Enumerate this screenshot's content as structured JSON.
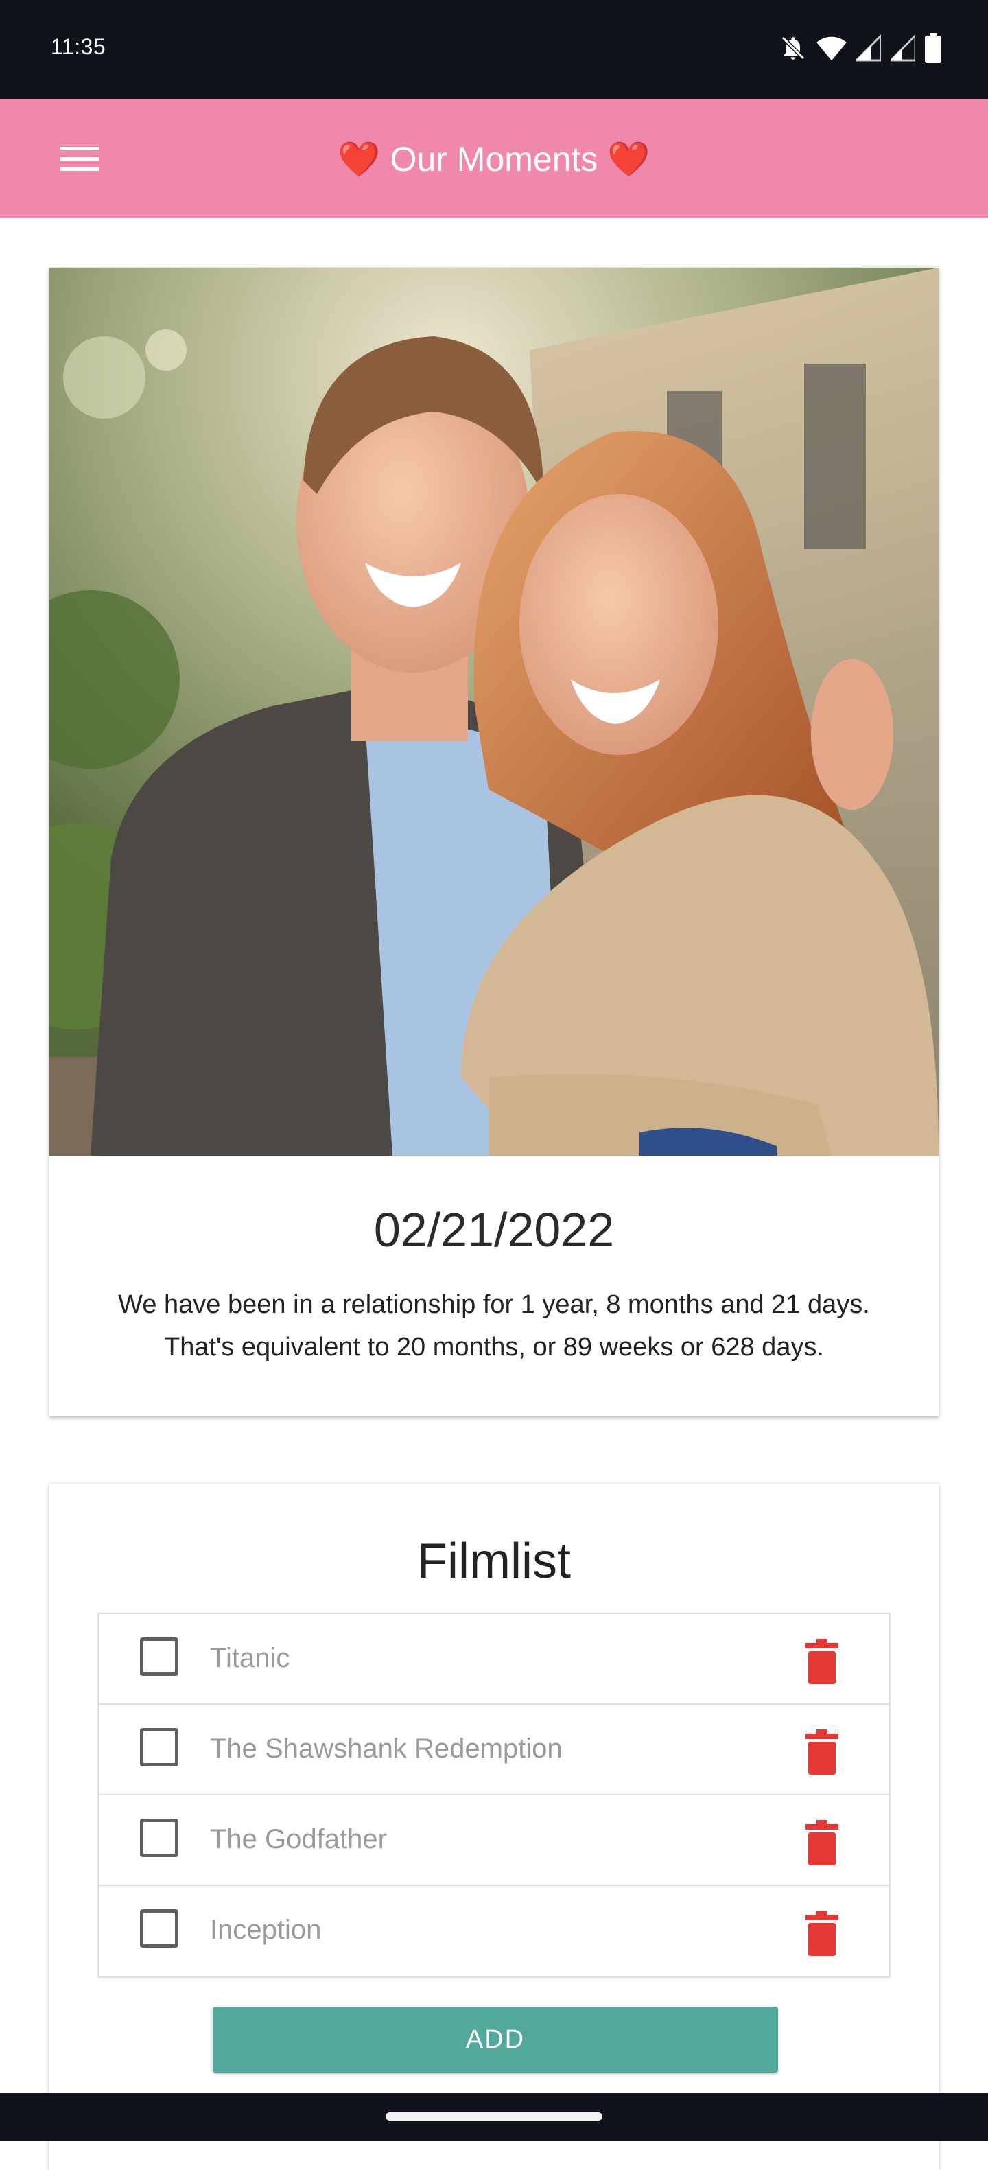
{
  "status_bar": {
    "time": "11:35",
    "icons": [
      "mute-icon",
      "wifi-icon",
      "signal-icon",
      "signal-icon",
      "battery-icon"
    ]
  },
  "app_bar": {
    "title": "Our Moments",
    "title_prefix": "❤️",
    "title_suffix": "❤️",
    "menu_icon": "hamburger-menu-icon",
    "color": "#f088ab"
  },
  "moment_card": {
    "photo": "couple-photo",
    "date": "02/21/2022",
    "relationship_line1": "We have been in a relationship for 1 year, 8 months and 21 days.",
    "relationship_line2": "That's equivalent to 20 months, or 89 weeks or 628 days."
  },
  "filmlist": {
    "title": "Filmlist",
    "items": [
      {
        "label": "Titanic",
        "checked": false
      },
      {
        "label": "The Shawshank Redemption",
        "checked": false
      },
      {
        "label": "The Godfather",
        "checked": false
      },
      {
        "label": "Inception",
        "checked": false
      }
    ],
    "delete_icon": "trash-icon",
    "delete_color": "#e53935",
    "add_label": "ADD",
    "add_color": "#52a89a"
  }
}
